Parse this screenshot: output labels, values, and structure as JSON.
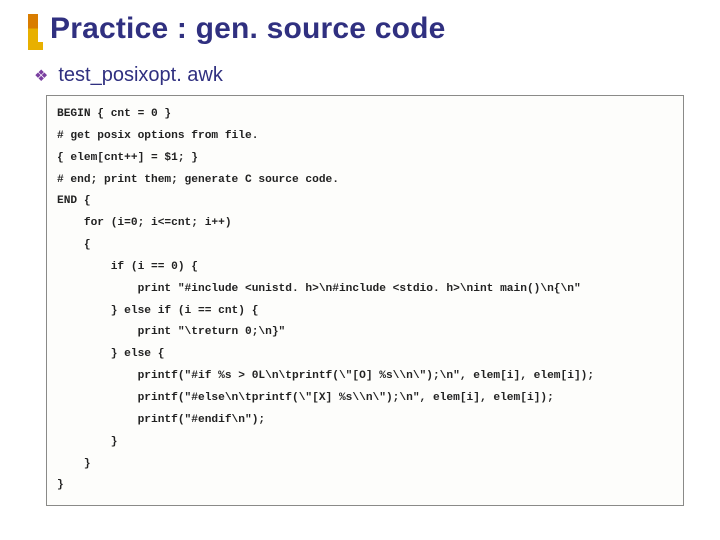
{
  "title": "Practice : gen. source code",
  "subhead": "test_posixopt. awk",
  "code_lines": [
    "BEGIN { cnt = 0 }",
    "# get posix options from file.",
    "{ elem[cnt++] = $1; }",
    "# end; print them; generate C source code.",
    "END {",
    "    for (i=0; i<=cnt; i++)",
    "    {",
    "        if (i == 0) {",
    "            print \"#include <unistd. h>\\n#include <stdio. h>\\nint main()\\n{\\n\"",
    "        } else if (i == cnt) {",
    "            print \"\\treturn 0;\\n}\"",
    "        } else {",
    "            printf(\"#if %s > 0L\\n\\tprintf(\\\"[O] %s\\\\n\\\");\\n\", elem[i], elem[i]);",
    "            printf(\"#else\\n\\tprintf(\\\"[X] %s\\\\n\\\");\\n\", elem[i], elem[i]);",
    "            printf(\"#endif\\n\");",
    "        }",
    "    }",
    "}"
  ]
}
